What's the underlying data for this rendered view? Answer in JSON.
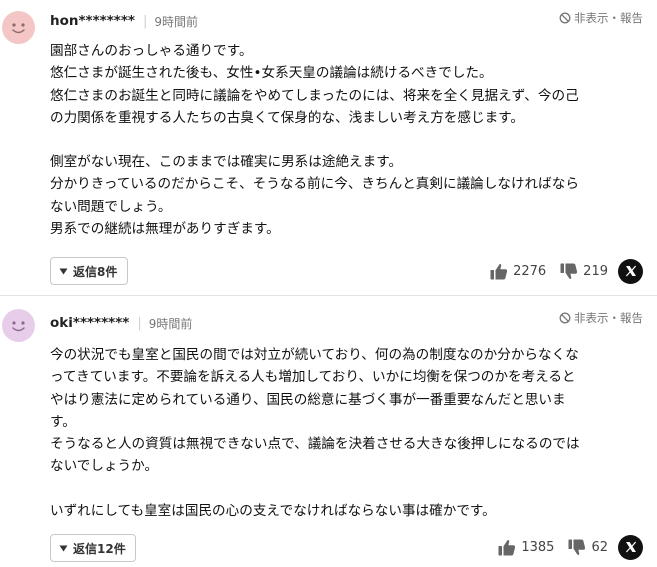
{
  "comments": [
    {
      "user": "hon********",
      "time": "9時間前",
      "report_label": "非表示・報告",
      "lines": [
        "園部さんのおっしゃる通りです。",
        "悠仁さまが誕生された後も、女性•女系天皇の議論は続けるべきでした。",
        "悠仁さまのお誕生と同時に議論をやめてしまったのには、将来を全く見据えず、今の己",
        "の力関係を重視する人たちの古臭くて保身的な、浅ましい考え方を感じます。",
        "",
        "側室がない現在、このままでは確実に男系は途絶えます。",
        "分かりきっているのだからこそ、そうなる前に今、きちんと真剣に議論しなければなら",
        "ない問題でしょう。",
        "男系での継続は無理がありすぎます。"
      ],
      "reply_label": "返信8件",
      "likes": "2276",
      "dislikes": "219",
      "avatar_color": "#f4c6c6"
    },
    {
      "user": "oki********",
      "time": "9時間前",
      "report_label": "非表示・報告",
      "lines": [
        "今の状況でも皇室と国民の間では対立が続いており、何の為の制度なのか分からなくな",
        "ってきています。不要論を訴える人も増加しており、いかに均衡を保つのかを考えると",
        "やはり憲法に定められている通り、国民の総意に基づく事が一番重要なんだと思いま",
        "す。",
        "そうなると人の資質は無視できない点で、議論を決着させる大きな後押しになるのでは",
        "ないでしょうか。",
        "",
        "いずれにしても皇室は国民の心の支えでなければならない事は確かです。"
      ],
      "reply_label": "返信12件",
      "likes": "1385",
      "dislikes": "62",
      "avatar_color": "#e7cdea"
    }
  ],
  "icons": {
    "avatar": "smiley-face-icon",
    "report": "ban-icon",
    "reply": "triangle-down-icon",
    "like": "thumbs-up-icon",
    "dislike": "thumbs-down-icon",
    "share": "x-logo-icon"
  }
}
